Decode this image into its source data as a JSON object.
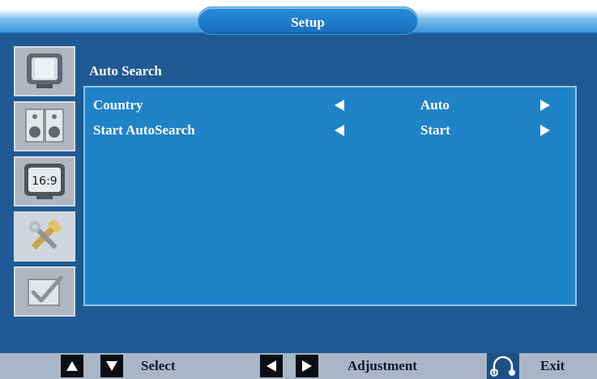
{
  "header": {
    "title": "Setup"
  },
  "sidebar": {
    "items": [
      {
        "icon": "tv-picture-icon"
      },
      {
        "icon": "speakers-audio-icon"
      },
      {
        "icon": "aspect-ratio-16-9-icon",
        "text": "16:9"
      },
      {
        "icon": "tools-setup-icon",
        "selected": true
      },
      {
        "icon": "checkbox-icon"
      }
    ]
  },
  "main": {
    "section_title": "Auto Search",
    "rows": [
      {
        "label": "Country",
        "value": "Auto"
      },
      {
        "label": "Start AutoSearch",
        "value": "Start"
      }
    ]
  },
  "footer": {
    "select_label": "Select",
    "adjust_label": "Adjustment",
    "exit_label": "Exit"
  },
  "colors": {
    "background": "#1f5a94",
    "panel": "#1f83c8",
    "bottom_bar": "#a9b6c7"
  }
}
